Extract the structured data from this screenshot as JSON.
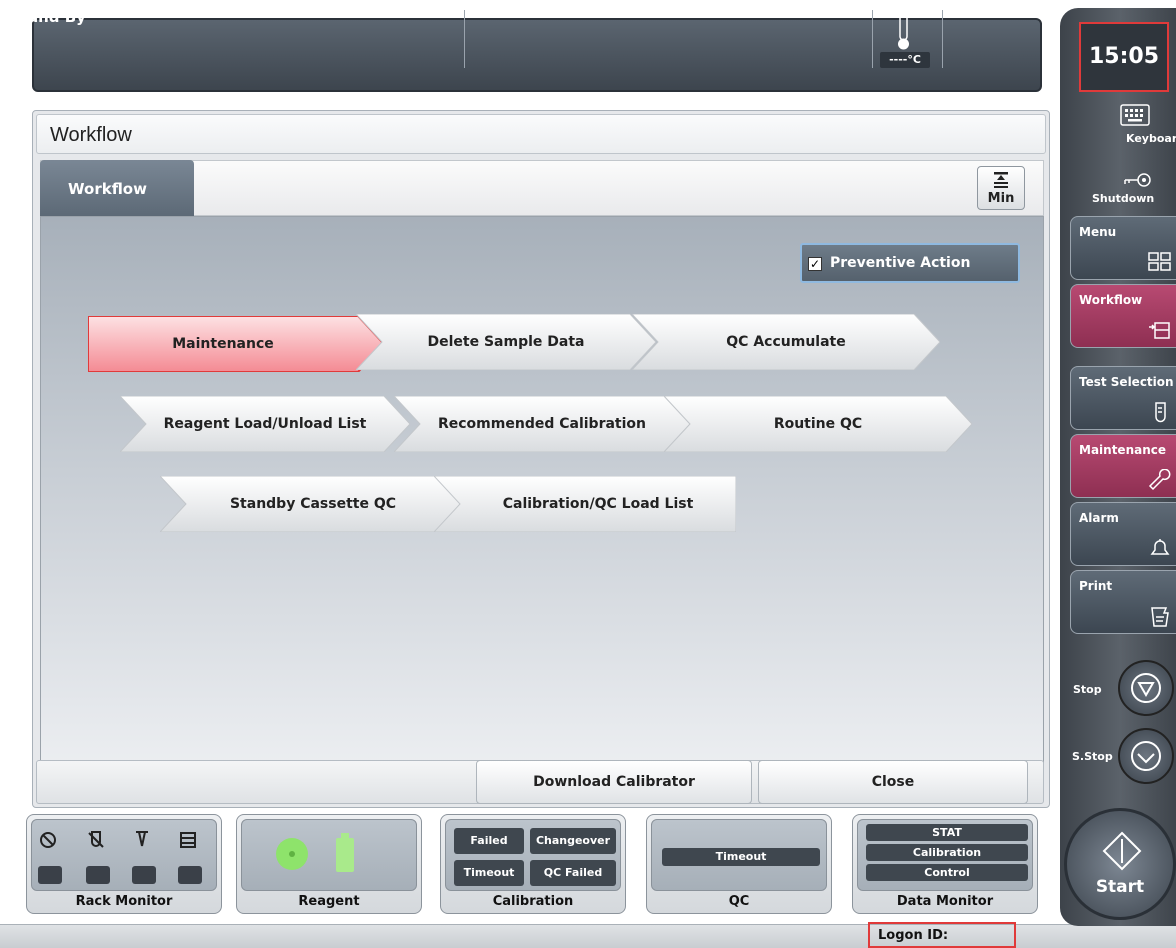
{
  "top_bar": {
    "status": "Stand By",
    "temperature": "----°C"
  },
  "window": {
    "title": "Workflow",
    "tab_label": "Workflow",
    "min_label": "Min",
    "preventive_action": {
      "label": "Preventive Action",
      "checked": true
    }
  },
  "workflow_steps": [
    {
      "label": "Maintenance",
      "active": true
    },
    {
      "label": "Delete Sample Data",
      "active": false
    },
    {
      "label": "QC Accumulate",
      "active": false
    },
    {
      "label": "Reagent Load/Unload List",
      "active": false
    },
    {
      "label": "Recommended Calibration",
      "active": false
    },
    {
      "label": "Routine QC",
      "active": false
    },
    {
      "label": "Standby Cassette QC",
      "active": false
    },
    {
      "label": "Calibration/QC Load List",
      "active": false
    }
  ],
  "dialog_buttons": {
    "download": "Download Calibrator",
    "close": "Close"
  },
  "monitors": {
    "rack": {
      "label": "Rack Monitor"
    },
    "reagent": {
      "label": "Reagent"
    },
    "calibration": {
      "label": "Calibration",
      "pills": [
        "Failed",
        "Changeover",
        "Timeout",
        "QC Failed"
      ]
    },
    "qc": {
      "label": "QC",
      "pills": [
        "Timeout"
      ]
    },
    "data": {
      "label": "Data Monitor",
      "pills": [
        "STAT",
        "Calibration",
        "Control"
      ]
    }
  },
  "footer": {
    "logon": "Logon ID:"
  },
  "sidebar": {
    "time": "15:05",
    "keyboard": "Keyboard",
    "shutdown": "Shutdown",
    "menu_items": [
      {
        "label": "Menu",
        "style": "grey"
      },
      {
        "label": "Workflow",
        "style": "pink"
      },
      {
        "label": "Test Selection",
        "style": "grey"
      },
      {
        "label": "Maintenance",
        "style": "pink"
      },
      {
        "label": "Alarm",
        "style": "grey"
      },
      {
        "label": "Print",
        "style": "grey"
      }
    ],
    "stop": "Stop",
    "sstop": "S.Stop",
    "start": "Start"
  },
  "colors": {
    "active_step": "#f6a9b0",
    "pink_menu": "#a63c63",
    "highlight": "#e03a3a"
  }
}
